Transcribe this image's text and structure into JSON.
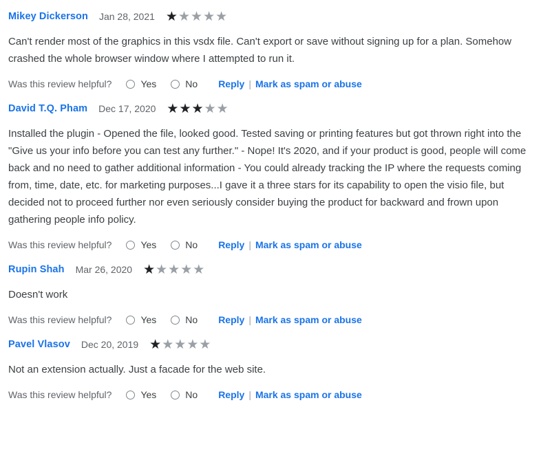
{
  "helpful": {
    "question": "Was this review helpful?",
    "yes_label": "Yes",
    "no_label": "No",
    "reply_label": "Reply",
    "separator": "|",
    "spam_label": "Mark as spam or abuse"
  },
  "colors": {
    "link": "#1a73e8",
    "star_filled": "#202124",
    "star_empty": "#9aa0a6",
    "text": "#3c4043",
    "muted": "#5f6368"
  },
  "star_glyph": "★",
  "reviews": [
    {
      "author": "Mikey Dickerson",
      "date": "Jan 28, 2021",
      "rating": 1,
      "max_rating": 5,
      "body": "Can't render most of the graphics in this vsdx file.  Can't export or save without signing up for a plan. Somehow crashed the whole browser window where I attempted to run it."
    },
    {
      "author": "David T.Q. Pham",
      "date": "Dec 17, 2020",
      "rating": 3,
      "max_rating": 5,
      "body": "Installed the plugin - Opened the file, looked good.  Tested saving or printing features but got thrown right into the \"Give us your info before you can test any further.\" - Nope!  It's 2020, and if your product is good, people will come back and no need to gather additional information - You could already tracking the IP where the requests coming from, time, date, etc. for marketing purposes...I gave it a three stars for its capability to open the visio file, but decided not to proceed further nor even seriously consider buying the product for backward and frown upon gathering people info policy."
    },
    {
      "author": "Rupin Shah",
      "date": "Mar 26, 2020",
      "rating": 1,
      "max_rating": 5,
      "body": "Doesn't work"
    },
    {
      "author": "Pavel Vlasov",
      "date": "Dec 20, 2019",
      "rating": 1,
      "max_rating": 5,
      "body": "Not an extension actually. Just a facade for the web site."
    }
  ]
}
